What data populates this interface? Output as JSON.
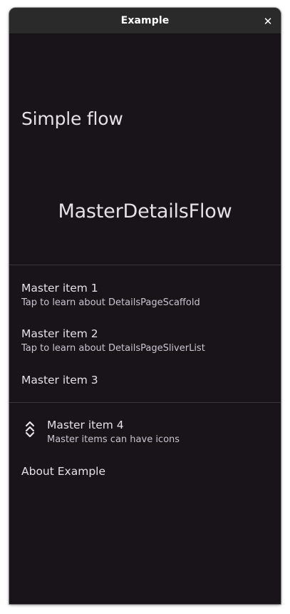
{
  "window": {
    "title": "Example"
  },
  "header": {
    "title": "Simple flow",
    "subtitle": "MasterDetailsFlow"
  },
  "items": [
    {
      "title": "Master item 1",
      "subtitle": "Tap to learn about DetailsPageScaffold"
    },
    {
      "title": "Master item 2",
      "subtitle": "Tap to learn about DetailsPageSliverList"
    },
    {
      "title": "Master item 3"
    },
    {
      "title": "Master item 4",
      "subtitle": "Master items can have icons",
      "icon": "chevrons-icon"
    },
    {
      "title": "About Example"
    }
  ],
  "colors": {
    "background": "#18141a",
    "titlebar": "#2a2a2a",
    "text": "#e6e0e9",
    "subtext": "#cac4d0",
    "divider": "#3a353d"
  }
}
